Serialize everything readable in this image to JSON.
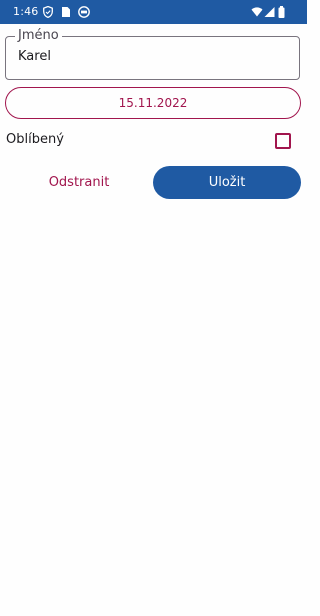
{
  "status_bar": {
    "time": "1:46",
    "icons": [
      "shield-icon",
      "sim-card-icon",
      "sync-icon",
      "wifi-icon",
      "signal-icon",
      "battery-icon"
    ]
  },
  "form": {
    "name_label": "Jméno",
    "name_value": "Karel",
    "date_value": "15.11.2022",
    "favorite_label": "Oblíbený",
    "favorite_checked": false
  },
  "actions": {
    "delete_label": "Odstranit",
    "save_label": "Uložit"
  },
  "colors": {
    "primary": "#1f5aa3",
    "accent": "#a1154d",
    "background": "#fefefe"
  }
}
